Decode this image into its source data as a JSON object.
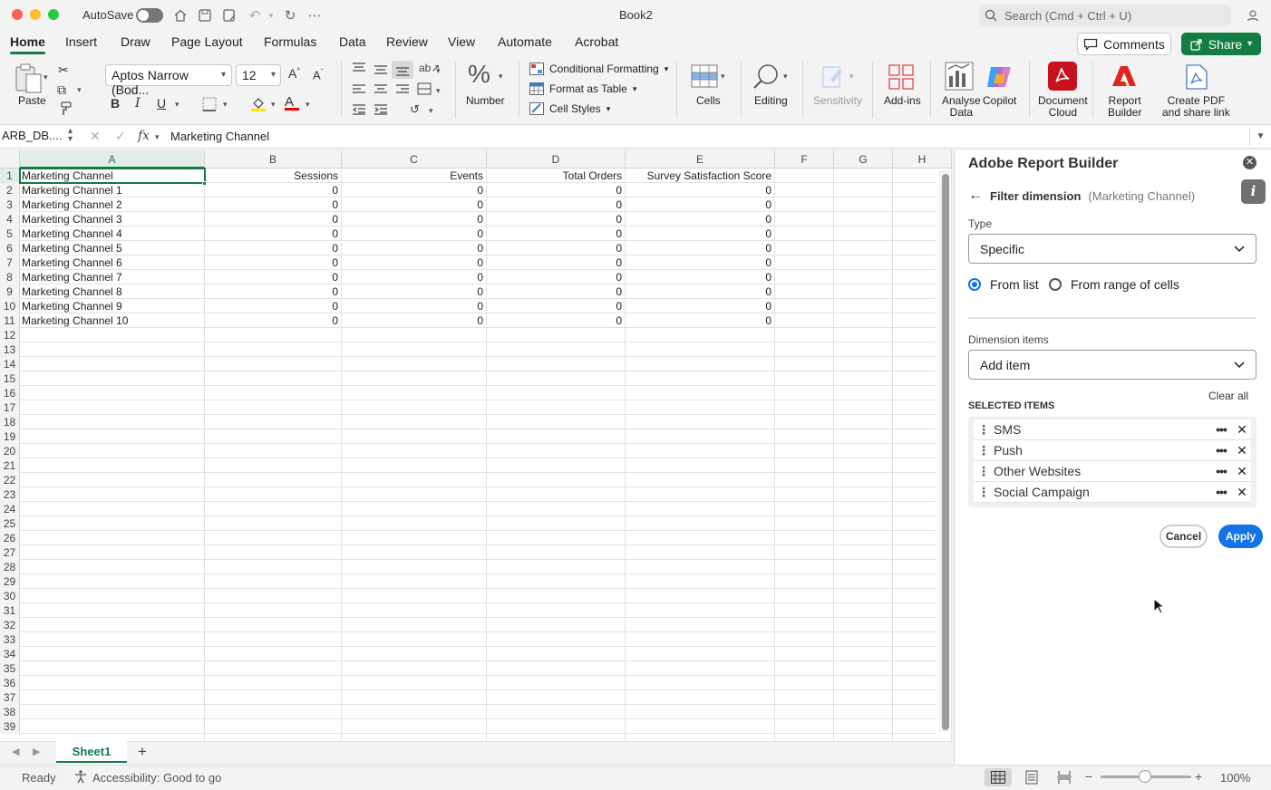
{
  "window": {
    "title": "Book2",
    "autosave_label": "AutoSave"
  },
  "search": {
    "placeholder": "Search (Cmd + Ctrl + U)"
  },
  "tabs": [
    "Home",
    "Insert",
    "Draw",
    "Page Layout",
    "Formulas",
    "Data",
    "Review",
    "View",
    "Automate",
    "Acrobat"
  ],
  "header_buttons": {
    "comments": "Comments",
    "share": "Share"
  },
  "ribbon": {
    "paste": "Paste",
    "font_name": "Aptos Narrow (Bod...",
    "font_size": "12",
    "number": "Number",
    "conditional_formatting": "Conditional Formatting",
    "format_as_table": "Format as Table",
    "cell_styles": "Cell Styles",
    "cells": "Cells",
    "editing": "Editing",
    "sensitivity": "Sensitivity",
    "addins": "Add-ins",
    "analyse_data": [
      "Analyse",
      "Data"
    ],
    "copilot": "Copilot",
    "document_cloud": [
      "Document",
      "Cloud"
    ],
    "report_builder": [
      "Report",
      "Builder"
    ],
    "create_pdf": [
      "Create PDF",
      "and share link"
    ]
  },
  "formula_bar": {
    "name_box": "ARB_DB....",
    "fx": "fx",
    "content": "Marketing Channel"
  },
  "columns": [
    "A",
    "B",
    "C",
    "D",
    "E",
    "F",
    "G",
    "H"
  ],
  "sheet": {
    "headers": [
      "Marketing Channel",
      "Sessions",
      "Events",
      "Total Orders",
      "Survey Satisfaction Score"
    ],
    "rows": [
      [
        "Marketing Channel 1",
        "0",
        "0",
        "0",
        "0"
      ],
      [
        "Marketing Channel 2",
        "0",
        "0",
        "0",
        "0"
      ],
      [
        "Marketing Channel 3",
        "0",
        "0",
        "0",
        "0"
      ],
      [
        "Marketing Channel 4",
        "0",
        "0",
        "0",
        "0"
      ],
      [
        "Marketing Channel 5",
        "0",
        "0",
        "0",
        "0"
      ],
      [
        "Marketing Channel 6",
        "0",
        "0",
        "0",
        "0"
      ],
      [
        "Marketing Channel 7",
        "0",
        "0",
        "0",
        "0"
      ],
      [
        "Marketing Channel 8",
        "0",
        "0",
        "0",
        "0"
      ],
      [
        "Marketing Channel 9",
        "0",
        "0",
        "0",
        "0"
      ],
      [
        "Marketing Channel 10",
        "0",
        "0",
        "0",
        "0"
      ]
    ],
    "row_count": 39
  },
  "sheet_tabs": {
    "active": "Sheet1",
    "add": "+"
  },
  "status": {
    "ready": "Ready",
    "accessibility": "Accessibility: Good to go",
    "zoom": "100%"
  },
  "panel": {
    "title": "Adobe Report Builder",
    "subtitle": "Filter dimension",
    "subtitle_context": "(Marketing Channel)",
    "type_label": "Type",
    "type_value": "Specific",
    "radio_from_list": "From list",
    "radio_from_range": "From range of cells",
    "dimension_items_label": "Dimension items",
    "add_item": "Add item",
    "selected_items_label": "SELECTED ITEMS",
    "clear_all": "Clear all",
    "selected_items": [
      "SMS",
      "Push",
      "Other Websites",
      "Social Campaign"
    ],
    "cancel": "Cancel",
    "apply": "Apply"
  },
  "colors": {
    "excel_green": "#107c41",
    "adobe_blue": "#1473e6",
    "adobe_red": "#d7261e"
  }
}
